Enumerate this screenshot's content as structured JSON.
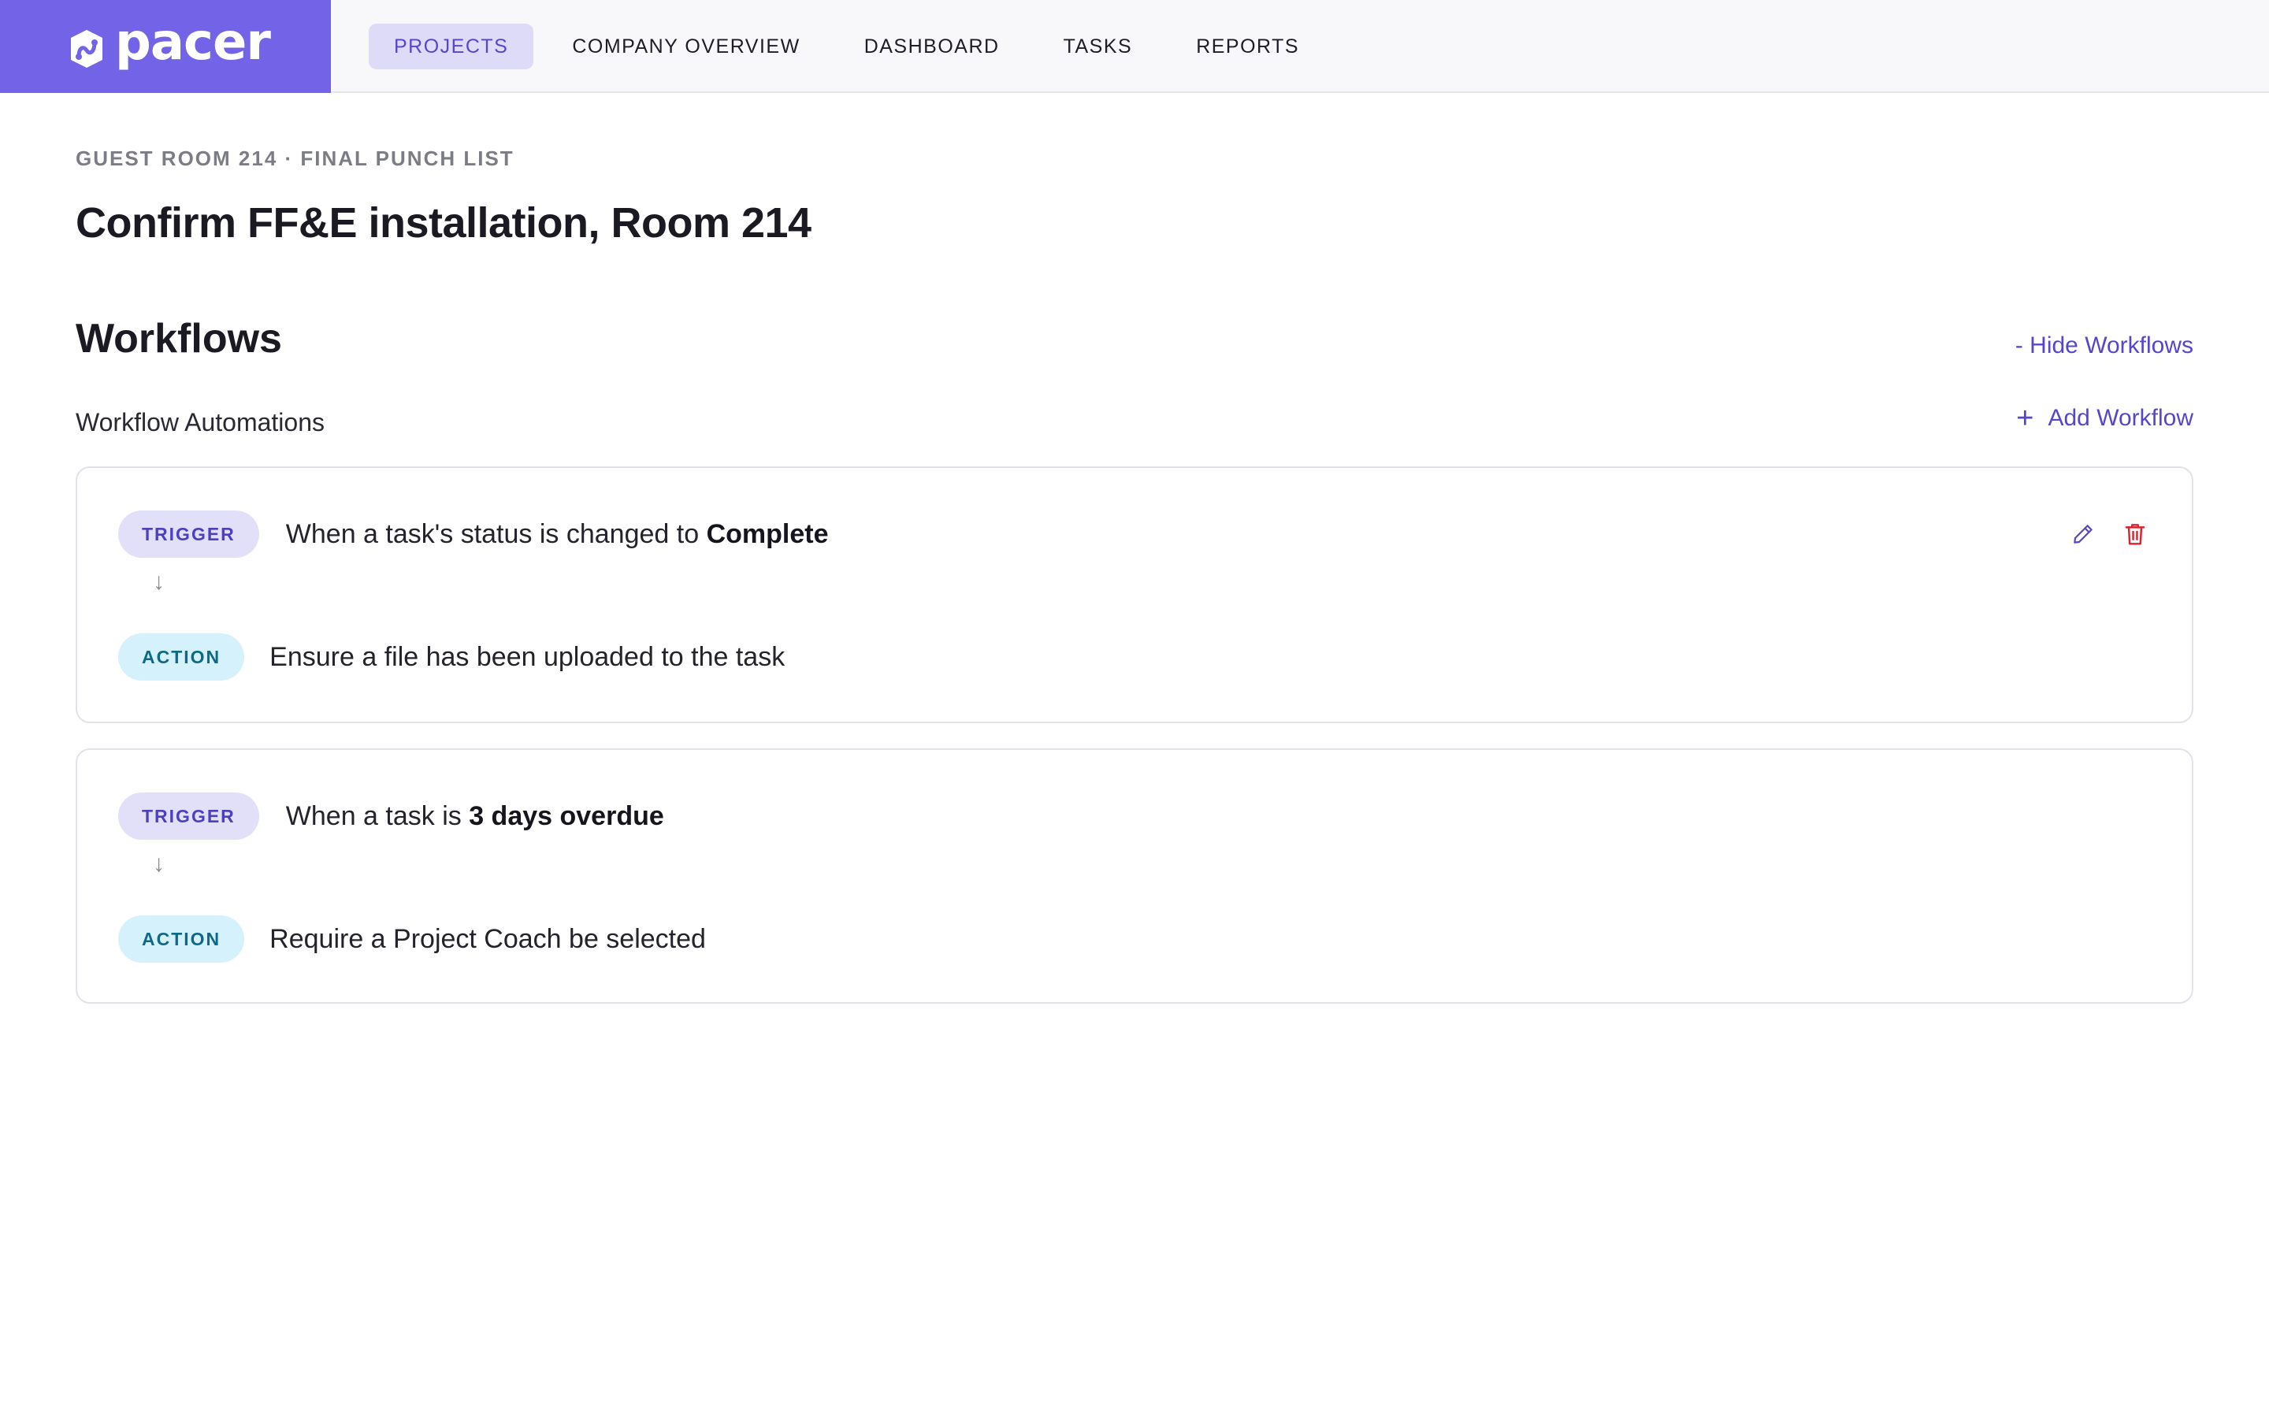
{
  "brand": {
    "name": "pacer",
    "color": "#7363e6"
  },
  "nav": {
    "items": [
      {
        "label": "PROJECTS",
        "active": true
      },
      {
        "label": "COMPANY OVERVIEW",
        "active": false
      },
      {
        "label": "DASHBOARD",
        "active": false
      },
      {
        "label": "TASKS",
        "active": false
      },
      {
        "label": "REPORTS",
        "active": false
      }
    ]
  },
  "page": {
    "breadcrumb": "GUEST ROOM 214 · FINAL PUNCH LIST",
    "title": "Confirm FF&E installation, Room 214"
  },
  "workflows": {
    "section_title": "Workflows",
    "hide_label": "- Hide Workflows",
    "subsection_title": "Workflow Automations",
    "add_label": "Add Workflow",
    "add_icon": "plus-icon",
    "items": [
      {
        "trigger_badge": "TRIGGER",
        "trigger_prefix": "When a task's status is changed to ",
        "trigger_value": "Complete",
        "arrow": "↓",
        "action_badge": "ACTION",
        "action_text": "Ensure a file has been uploaded to the task",
        "icons": [
          "pencil-icon",
          "trash-icon"
        ]
      },
      {
        "trigger_badge": "TRIGGER",
        "trigger_prefix": "When a task is ",
        "trigger_value": "3 days overdue",
        "arrow": "↓",
        "action_badge": "ACTION",
        "action_text": "Require a Project Coach be selected",
        "icons": []
      }
    ]
  },
  "colors": {
    "accent": "#5646cc",
    "trigger_badge_bg": "#e2e0f8",
    "action_badge_bg": "#d5f1fb",
    "delete": "#d9232e"
  }
}
